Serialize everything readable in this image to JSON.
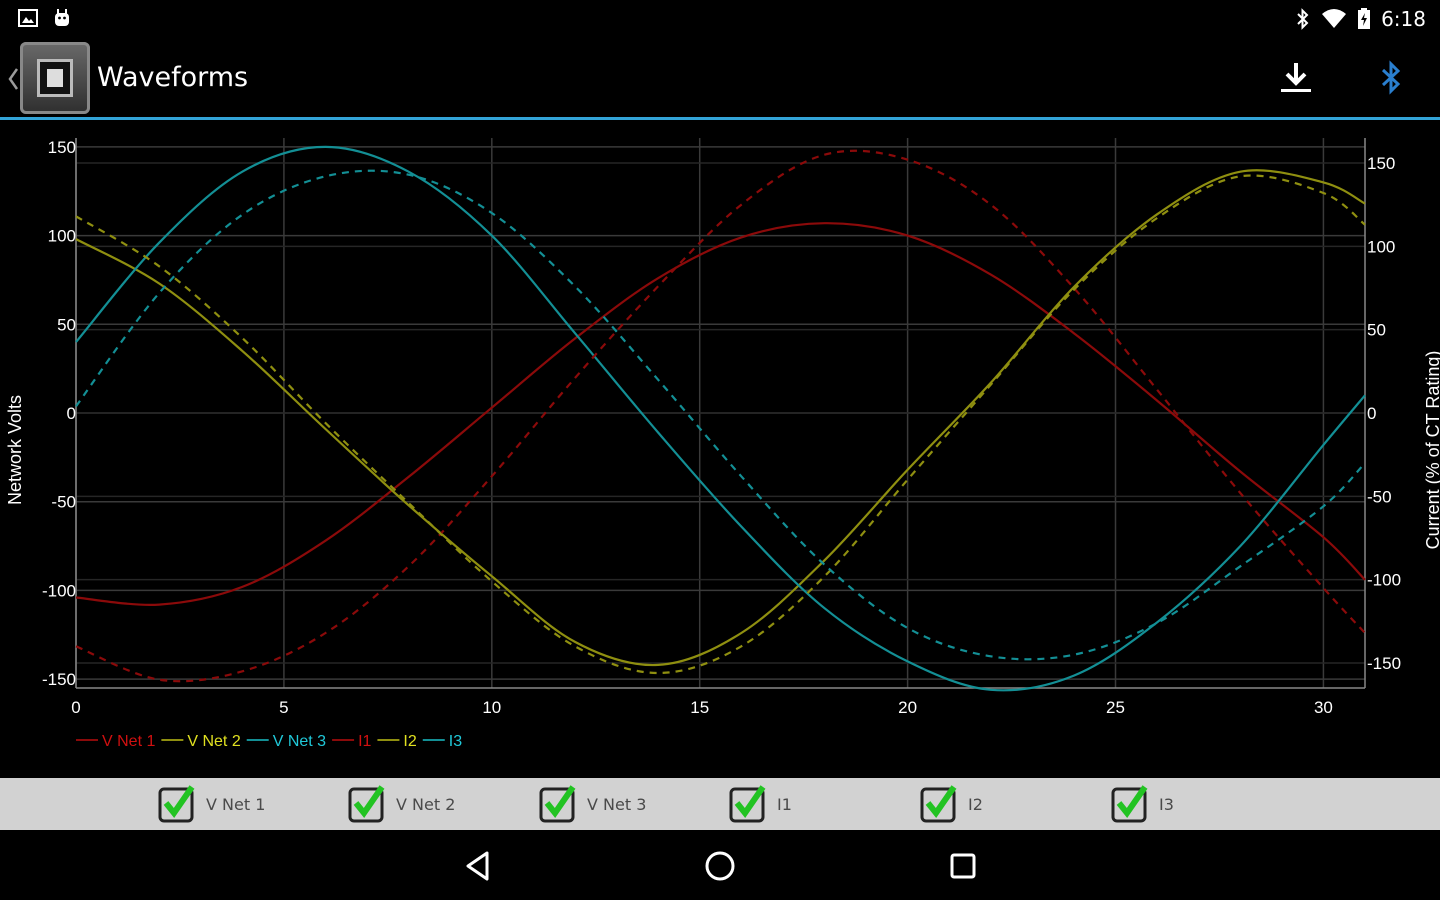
{
  "status_bar": {
    "time": "6:18",
    "left_icons": [
      "image-icon",
      "android-debug-icon"
    ],
    "right_icons": [
      "bluetooth-icon",
      "wifi-icon",
      "battery-icon"
    ]
  },
  "action_bar": {
    "title": "Waveforms",
    "actions": [
      "download-icon",
      "bluetooth-icon"
    ],
    "accent_color": "#33a4d8"
  },
  "chart_data": {
    "type": "line",
    "xlabel": "",
    "ylabel": "Network Volts",
    "y2label": "Current (% of CT Rating)",
    "xlim": [
      0,
      31
    ],
    "ylim": [
      -155,
      155
    ],
    "y2lim": [
      -165,
      165
    ],
    "x_ticks": [
      0,
      5,
      10,
      15,
      20,
      25,
      30
    ],
    "y_ticks": [
      150,
      100,
      50,
      0,
      -50,
      -100,
      -150
    ],
    "y2_ticks": [
      150,
      100,
      50,
      0,
      -50,
      -100,
      -150
    ],
    "grid": true,
    "legend_position": "bottom-left",
    "x": [
      0,
      2,
      4,
      6,
      8,
      10,
      12,
      14,
      16,
      18,
      20,
      22,
      24,
      26,
      28,
      30,
      31
    ],
    "series": [
      {
        "name": "V Net 1",
        "axis": "left",
        "style": "solid",
        "color": "#8b0a0a",
        "values": [
          -104,
          -108,
          -98,
          -72,
          -36,
          3,
          42,
          76,
          99,
          107,
          100,
          78,
          45,
          7,
          -33,
          -70,
          -94
        ]
      },
      {
        "name": "V Net 2",
        "axis": "left",
        "style": "solid",
        "color": "#8f8f10",
        "values": [
          98,
          73,
          35,
          -9,
          -52,
          -92,
          -129,
          -142,
          -124,
          -83,
          -32,
          17,
          71,
          112,
          136,
          130,
          118
        ]
      },
      {
        "name": "V Net 3",
        "axis": "left",
        "style": "solid",
        "color": "#138f95",
        "values": [
          40,
          96,
          136,
          150,
          136,
          100,
          45,
          -11,
          -64,
          -110,
          -140,
          -156,
          -148,
          -118,
          -75,
          -18,
          10
        ]
      },
      {
        "name": "I1",
        "axis": "right",
        "style": "dashed",
        "color": "#8b0a0a",
        "values": [
          -140,
          -160,
          -155,
          -132,
          -92,
          -38,
          21,
          76,
          125,
          155,
          152,
          125,
          75,
          14,
          -48,
          -105,
          -132
        ]
      },
      {
        "name": "I2",
        "axis": "right",
        "style": "dashed",
        "color": "#8f8f10",
        "values": [
          118,
          88,
          45,
          -6,
          -54,
          -101,
          -140,
          -156,
          -140,
          -98,
          -40,
          17,
          74,
          117,
          142,
          132,
          113
        ]
      },
      {
        "name": "I3",
        "axis": "right",
        "style": "dashed",
        "color": "#138f95",
        "values": [
          4,
          72,
          119,
          142,
          143,
          120,
          76,
          20,
          -38,
          -91,
          -129,
          -146,
          -145,
          -126,
          -92,
          -56,
          -30
        ]
      }
    ]
  },
  "checkboxes": [
    {
      "label": "V Net 1",
      "checked": true
    },
    {
      "label": "V Net 2",
      "checked": true
    },
    {
      "label": "V Net 3",
      "checked": true
    },
    {
      "label": "I1",
      "checked": true
    },
    {
      "label": "I2",
      "checked": true
    },
    {
      "label": "I3",
      "checked": true
    }
  ],
  "nav_bar": {
    "buttons": [
      "back-icon",
      "home-icon",
      "recents-icon"
    ]
  }
}
